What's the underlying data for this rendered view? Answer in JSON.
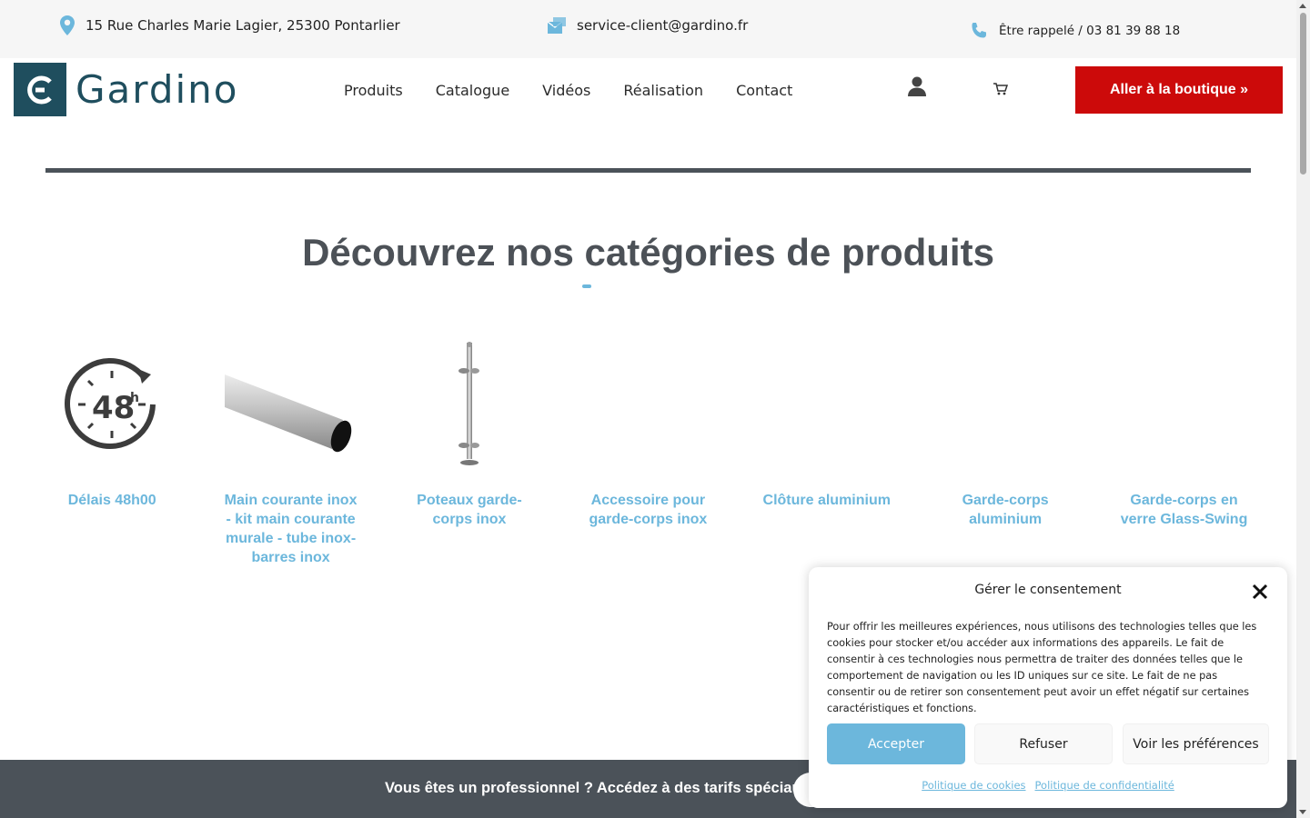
{
  "topbar": {
    "address": "15 Rue Charles Marie Lagier, 25300 Pontarlier",
    "email": "service-client@gardino.fr",
    "phone": "Être rappelé / 03 81 39 88 18"
  },
  "header": {
    "logo_text": "Gardino",
    "nav": [
      "Produits",
      "Catalogue",
      "Vidéos",
      "Réalisation",
      "Contact"
    ],
    "shop_button": "Aller à la boutique »"
  },
  "main": {
    "title": "Découvrez nos catégories de produits",
    "categories": [
      {
        "label": "Délais 48h00",
        "icon": "clock-48h-icon"
      },
      {
        "label": "Main courante inox - kit main courante murale - tube inox-barres inox",
        "icon": "steel-tube-image"
      },
      {
        "label": "Poteaux garde-corps inox",
        "icon": "steel-post-image"
      },
      {
        "label": "Accessoire pour garde-corps inox",
        "icon": ""
      },
      {
        "label": "Clôture aluminium",
        "icon": ""
      },
      {
        "label": "Garde-corps aluminium",
        "icon": ""
      },
      {
        "label": "Garde-corps en verre Glass-Swing",
        "icon": ""
      }
    ]
  },
  "pro_banner": {
    "text": "Vous êtes un professionnel ? Accédez à des tarifs spéciaux !"
  },
  "consent": {
    "title": "Gérer le consentement",
    "body": "Pour offrir les meilleures expériences, nous utilisons des technologies telles que les cookies pour stocker et/ou accéder aux informations des appareils. Le fait de consentir à ces technologies nous permettra de traiter des données telles que le comportement de navigation ou les ID uniques sur ce site. Le fait de ne pas consentir ou de retirer son consentement peut avoir un effet négatif sur certaines caractéristiques et fonctions.",
    "accept": "Accepter",
    "refuse": "Refuser",
    "preferences": "Voir les préférences",
    "cookie_policy": "Politique de cookies",
    "privacy_policy": "Politique de confidentialité"
  },
  "colors": {
    "accent_blue": "#6cb7dc",
    "brand_teal": "#1f4e5e",
    "shop_red": "#cc0a0a",
    "banner_gray": "#4b5259"
  }
}
